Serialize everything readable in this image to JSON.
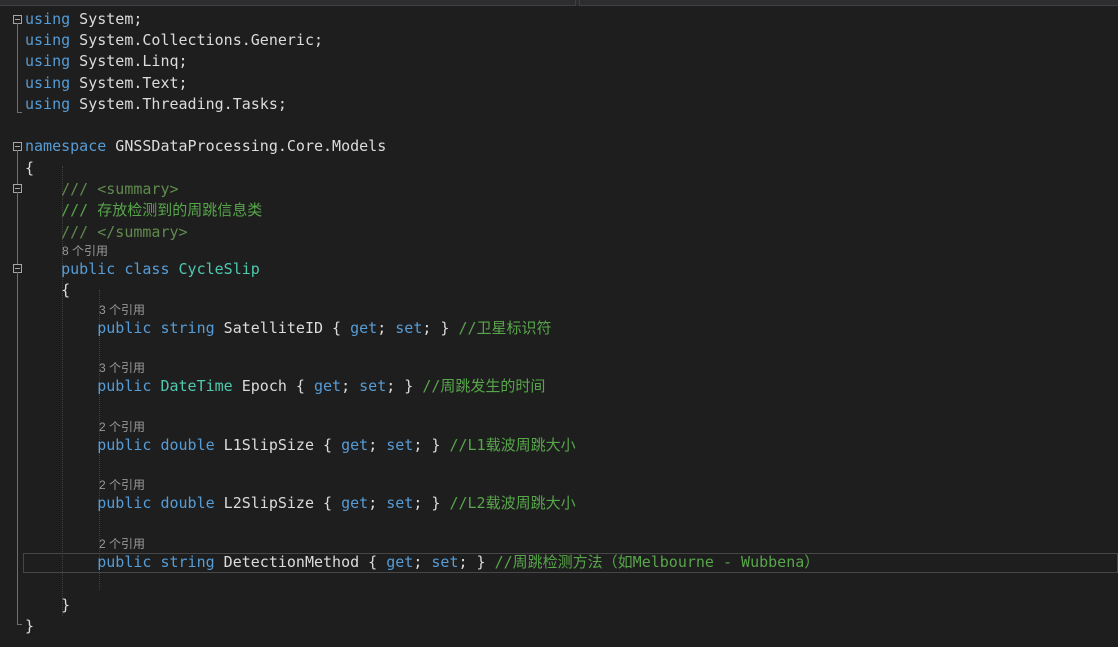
{
  "code": {
    "line1": [
      {
        "t": "using",
        "c": "kw"
      },
      {
        "t": " System;",
        "c": "pl"
      }
    ],
    "line2": [
      {
        "t": "using",
        "c": "kw"
      },
      {
        "t": " System.Collections.Generic;",
        "c": "pl"
      }
    ],
    "line3": [
      {
        "t": "using",
        "c": "kw"
      },
      {
        "t": " System.Linq;",
        "c": "pl"
      }
    ],
    "line4": [
      {
        "t": "using",
        "c": "kw"
      },
      {
        "t": " System.Text;",
        "c": "pl"
      }
    ],
    "line5": [
      {
        "t": "using",
        "c": "kw"
      },
      {
        "t": " System.Threading.Tasks;",
        "c": "pl"
      }
    ],
    "line7": [
      {
        "t": "namespace",
        "c": "kw"
      },
      {
        "t": " GNSSDataProcessing.Core.Models",
        "c": "pl"
      }
    ],
    "line8": [
      {
        "t": "{",
        "c": "pl"
      }
    ],
    "line9": [
      {
        "t": "    ",
        "c": "pl"
      },
      {
        "t": "/// <summary>",
        "c": "cmtag"
      }
    ],
    "line10": [
      {
        "t": "    ",
        "c": "pl"
      },
      {
        "t": "/// 存放检测到的周跳信息类",
        "c": "cm"
      }
    ],
    "line11": [
      {
        "t": "    ",
        "c": "pl"
      },
      {
        "t": "/// </summary>",
        "c": "cmtag"
      }
    ],
    "line12": [
      {
        "t": "    ",
        "c": "pl"
      },
      {
        "t": "public",
        "c": "kw"
      },
      {
        "t": " ",
        "c": "pl"
      },
      {
        "t": "class",
        "c": "kw"
      },
      {
        "t": " ",
        "c": "pl"
      },
      {
        "t": "CycleSlip",
        "c": "type"
      }
    ],
    "line13": [
      {
        "t": "    {",
        "c": "pl"
      }
    ],
    "line14": [
      {
        "t": "        ",
        "c": "pl"
      },
      {
        "t": "public",
        "c": "kw"
      },
      {
        "t": " ",
        "c": "pl"
      },
      {
        "t": "string",
        "c": "kw"
      },
      {
        "t": " SatelliteID { ",
        "c": "pl"
      },
      {
        "t": "get",
        "c": "kw"
      },
      {
        "t": "; ",
        "c": "pl"
      },
      {
        "t": "set",
        "c": "kw"
      },
      {
        "t": "; } ",
        "c": "pl"
      },
      {
        "t": "//卫星标识符",
        "c": "cm"
      }
    ],
    "line16": [
      {
        "t": "        ",
        "c": "pl"
      },
      {
        "t": "public",
        "c": "kw"
      },
      {
        "t": " ",
        "c": "pl"
      },
      {
        "t": "DateTime",
        "c": "type"
      },
      {
        "t": " Epoch { ",
        "c": "pl"
      },
      {
        "t": "get",
        "c": "kw"
      },
      {
        "t": "; ",
        "c": "pl"
      },
      {
        "t": "set",
        "c": "kw"
      },
      {
        "t": "; } ",
        "c": "pl"
      },
      {
        "t": "//周跳发生的时间",
        "c": "cm"
      }
    ],
    "line18": [
      {
        "t": "        ",
        "c": "pl"
      },
      {
        "t": "public",
        "c": "kw"
      },
      {
        "t": " ",
        "c": "pl"
      },
      {
        "t": "double",
        "c": "kw"
      },
      {
        "t": " L1SlipSize { ",
        "c": "pl"
      },
      {
        "t": "get",
        "c": "kw"
      },
      {
        "t": "; ",
        "c": "pl"
      },
      {
        "t": "set",
        "c": "kw"
      },
      {
        "t": "; } ",
        "c": "pl"
      },
      {
        "t": "//L1载波周跳大小",
        "c": "cm"
      }
    ],
    "line20": [
      {
        "t": "        ",
        "c": "pl"
      },
      {
        "t": "public",
        "c": "kw"
      },
      {
        "t": " ",
        "c": "pl"
      },
      {
        "t": "double",
        "c": "kw"
      },
      {
        "t": " L2SlipSize { ",
        "c": "pl"
      },
      {
        "t": "get",
        "c": "kw"
      },
      {
        "t": "; ",
        "c": "pl"
      },
      {
        "t": "set",
        "c": "kw"
      },
      {
        "t": "; } ",
        "c": "pl"
      },
      {
        "t": "//L2载波周跳大小",
        "c": "cm"
      }
    ],
    "line22": [
      {
        "t": "        ",
        "c": "pl"
      },
      {
        "t": "public",
        "c": "kw"
      },
      {
        "t": " ",
        "c": "pl"
      },
      {
        "t": "string",
        "c": "kw"
      },
      {
        "t": " DetectionMethod { ",
        "c": "pl"
      },
      {
        "t": "get",
        "c": "kw"
      },
      {
        "t": "; ",
        "c": "pl"
      },
      {
        "t": "set",
        "c": "kw"
      },
      {
        "t": "; } ",
        "c": "pl"
      },
      {
        "t": "//周跳检测方法（如Melbourne - Wubbena）",
        "c": "cm"
      }
    ],
    "line24": [
      {
        "t": "    }",
        "c": "pl"
      }
    ],
    "line25": [
      {
        "t": "}",
        "c": "pl"
      }
    ]
  },
  "references": {
    "class_refs": "8 个引用",
    "satelliteid_refs": "3 个引用",
    "epoch_refs": "3 个引用",
    "l1_refs": "2 个引用",
    "l2_refs": "2 个引用",
    "detection_refs": "2 个引用"
  }
}
